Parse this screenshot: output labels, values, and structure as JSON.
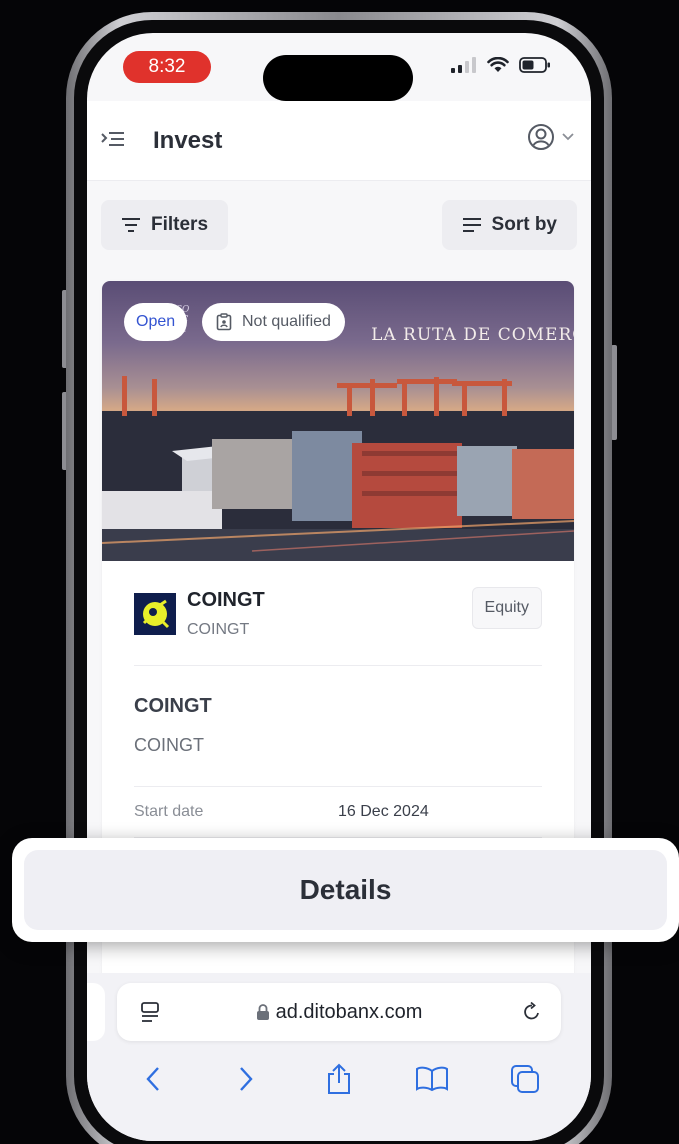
{
  "status": {
    "time": "8:32"
  },
  "header": {
    "title": "Invest"
  },
  "toolbar": {
    "filters_label": "Filters",
    "sort_label": "Sort by"
  },
  "card": {
    "badges": {
      "open": "Open",
      "qualification": "Not qualified"
    },
    "hero_text": "LA RUTA DE COMERCI",
    "company": {
      "name": "COINGT",
      "subtitle": "COINGT",
      "type": "Equity"
    },
    "offering": {
      "title": "COINGT",
      "subtitle": "COINGT"
    },
    "start_date": {
      "label": "Start date",
      "value": "16 Dec 2024"
    }
  },
  "details": {
    "label": "Details"
  },
  "browser": {
    "url": "ad.ditobanx.com"
  },
  "colors": {
    "accent": "#3454d1",
    "time_pill": "#e0322c",
    "logo_bg": "#0f1e4d",
    "logo_fg": "#e8ef2a"
  }
}
